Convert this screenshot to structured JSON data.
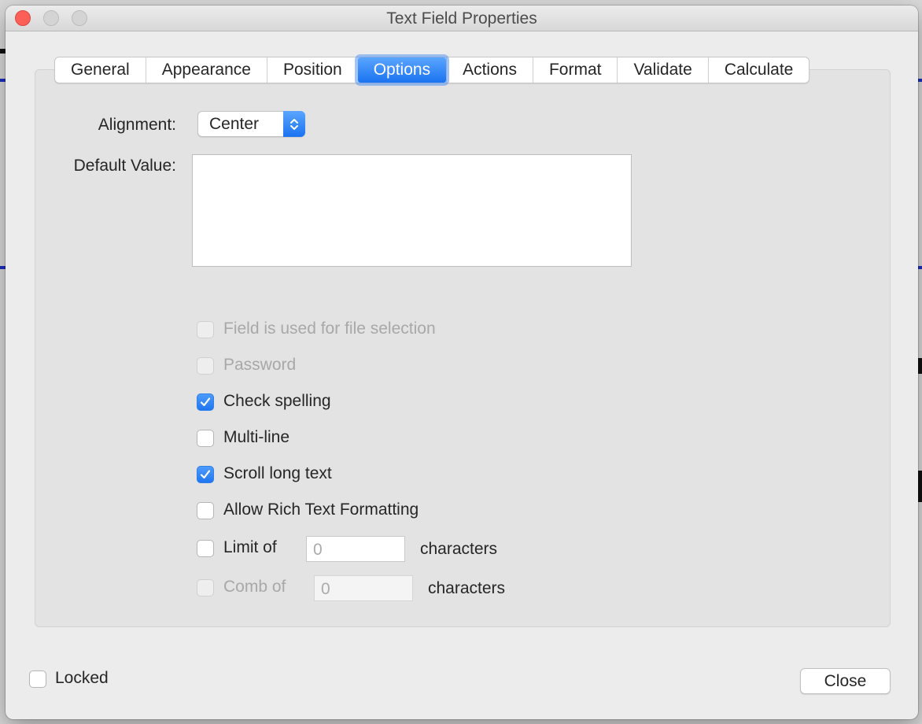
{
  "window": {
    "title": "Text Field Properties"
  },
  "tabs": [
    {
      "label": "General",
      "active": false
    },
    {
      "label": "Appearance",
      "active": false
    },
    {
      "label": "Position",
      "active": false
    },
    {
      "label": "Options",
      "active": true
    },
    {
      "label": "Actions",
      "active": false
    },
    {
      "label": "Format",
      "active": false
    },
    {
      "label": "Validate",
      "active": false
    },
    {
      "label": "Calculate",
      "active": false
    }
  ],
  "options": {
    "alignment_label": "Alignment:",
    "alignment_value": "Center",
    "default_value_label": "Default Value:",
    "default_value": "",
    "checkboxes": [
      {
        "label": "Field is used for file selection",
        "checked": false,
        "enabled": false
      },
      {
        "label": "Password",
        "checked": false,
        "enabled": false
      },
      {
        "label": "Check spelling",
        "checked": true,
        "enabled": true
      },
      {
        "label": "Multi-line",
        "checked": false,
        "enabled": true
      },
      {
        "label": "Scroll long text",
        "checked": true,
        "enabled": true
      },
      {
        "label": "Allow Rich Text Formatting",
        "checked": false,
        "enabled": true
      }
    ],
    "limit": {
      "label": "Limit of",
      "placeholder": "0",
      "suffix": "characters",
      "checked": false,
      "enabled": true
    },
    "comb": {
      "label": "Comb of",
      "placeholder": "0",
      "suffix": "characters",
      "checked": false,
      "enabled": false
    }
  },
  "footer": {
    "locked_label": "Locked",
    "locked_checked": false,
    "close_label": "Close"
  },
  "colors": {
    "accent": "#1a73f0",
    "close_red": "#fc5f57",
    "disabled_text": "#a8a8a8"
  },
  "icons": {
    "checkmark": "checkmark-icon",
    "popup_arrows": "chevron-up-down-icon"
  }
}
